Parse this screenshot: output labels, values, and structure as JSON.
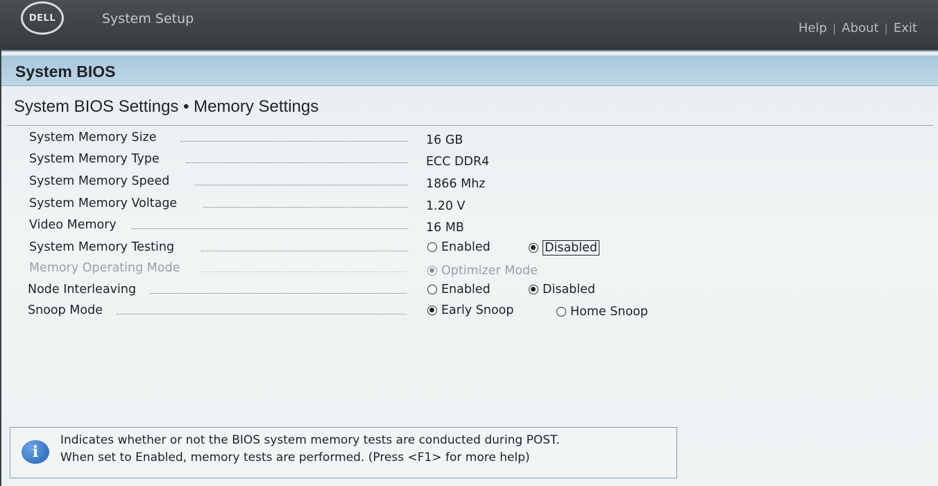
{
  "brand": {
    "logo_text": "DELL"
  },
  "app_title": "System Setup",
  "top_links": {
    "help": "Help",
    "about": "About",
    "exit": "Exit",
    "separator": "|"
  },
  "page_title": "System BIOS",
  "breadcrumb": "System BIOS Settings • Memory Settings",
  "settings": [
    {
      "label": "System Memory Size",
      "value": "16 GB"
    },
    {
      "label": "System Memory Type",
      "value": "ECC DDR4"
    },
    {
      "label": "System Memory Speed",
      "value": "1866 Mhz"
    },
    {
      "label": "System Memory Voltage",
      "value": "1.20 V"
    },
    {
      "label": "Video Memory",
      "value": "16 MB"
    },
    {
      "label": "System Memory Testing",
      "options": [
        "Enabled",
        "Disabled"
      ],
      "selected": "Disabled",
      "focused": "Disabled"
    },
    {
      "label": "Memory Operating Mode",
      "options": [
        "Optimizer Mode"
      ],
      "selected": "Optimizer Mode",
      "disabled": true
    },
    {
      "label": "Node Interleaving",
      "options": [
        "Enabled",
        "Disabled"
      ],
      "selected": "Disabled"
    },
    {
      "label": "Snoop Mode",
      "options": [
        "Early Snoop",
        "Home Snoop"
      ],
      "selected": "Early Snoop"
    }
  ],
  "help": {
    "icon": "info-icon",
    "line1": "Indicates whether or not the BIOS system memory tests are conducted during POST.",
    "line2": "When set to Enabled, memory tests are performed. (Press <F1> for more help)"
  }
}
